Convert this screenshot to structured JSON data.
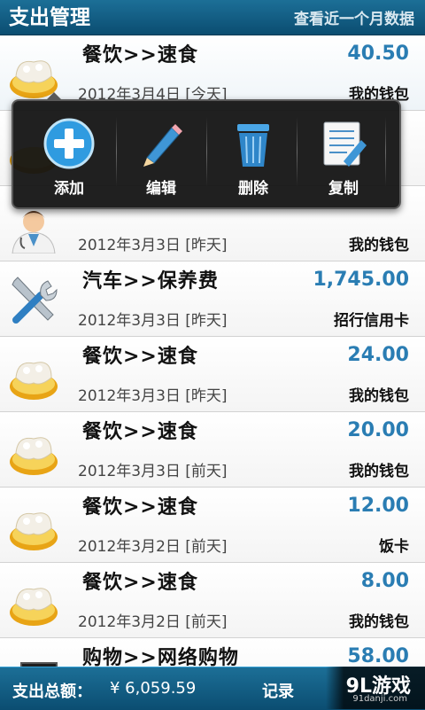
{
  "header": {
    "title": "支出管理",
    "link": "查看近一个月数据"
  },
  "popup": {
    "items": [
      {
        "label": "添加",
        "icon": "add-icon"
      },
      {
        "label": "编辑",
        "icon": "pencil-icon"
      },
      {
        "label": "删除",
        "icon": "trash-icon"
      },
      {
        "label": "复制",
        "icon": "copy-icon"
      }
    ]
  },
  "rows": [
    {
      "category": "餐饮>>速食",
      "amount": "40.50",
      "date": "2012年3月4日 [今天]",
      "account": "我的钱包",
      "icon": "food-icon"
    },
    {
      "category": "",
      "amount": "",
      "date": "",
      "account": "",
      "icon": "food-icon"
    },
    {
      "category": "",
      "amount": "",
      "date": "2012年3月3日 [昨天]",
      "account": "我的钱包",
      "icon": "doctor-icon"
    },
    {
      "category": "汽车>>保养费",
      "amount": "1,745.00",
      "date": "2012年3月3日 [昨天]",
      "account": "招行信用卡",
      "icon": "tools-icon"
    },
    {
      "category": "餐饮>>速食",
      "amount": "24.00",
      "date": "2012年3月3日 [昨天]",
      "account": "我的钱包",
      "icon": "food-icon"
    },
    {
      "category": "餐饮>>速食",
      "amount": "20.00",
      "date": "2012年3月3日 [前天]",
      "account": "我的钱包",
      "icon": "food-icon"
    },
    {
      "category": "餐饮>>速食",
      "amount": "12.00",
      "date": "2012年3月2日 [前天]",
      "account": "饭卡",
      "icon": "food-icon"
    },
    {
      "category": "餐饮>>速食",
      "amount": "8.00",
      "date": "2012年3月2日 [前天]",
      "account": "我的钱包",
      "icon": "food-icon"
    },
    {
      "category": "购物>>网络购物",
      "amount": "58.00",
      "date": "",
      "account": "",
      "icon": "shopping-icon"
    }
  ],
  "footer": {
    "total_label": "支出总额：",
    "total_value": "¥  6,059.59",
    "record_label": "记录"
  },
  "watermark": {
    "main": "9L游戏",
    "sub": "91danji.com"
  },
  "colors": {
    "bar": "#0b4d71",
    "amount": "#2a7db3"
  }
}
